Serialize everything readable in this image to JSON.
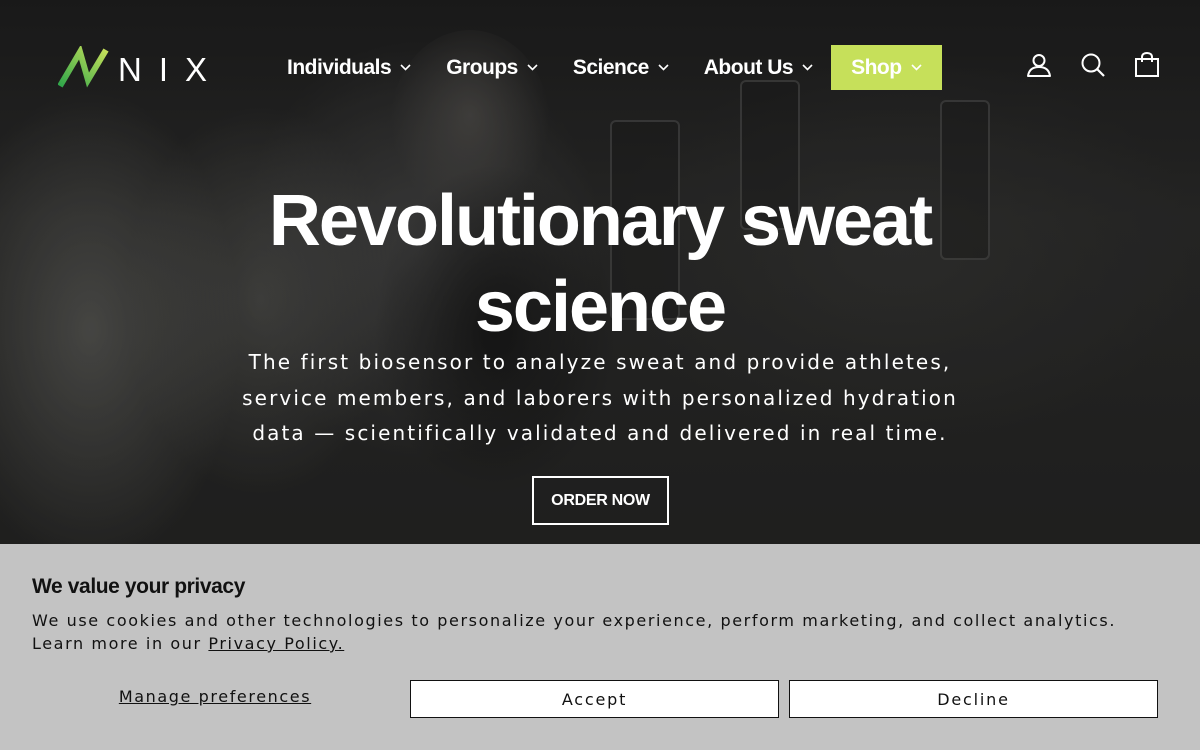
{
  "brand": {
    "name": "NIX",
    "accent_color": "#c6e05a"
  },
  "nav": {
    "items": [
      {
        "label": "Individuals",
        "icon": "chevron-down-icon"
      },
      {
        "label": "Groups",
        "icon": "chevron-down-icon"
      },
      {
        "label": "Science",
        "icon": "chevron-down-icon"
      },
      {
        "label": "About Us",
        "icon": "chevron-down-icon"
      },
      {
        "label": "Shop",
        "icon": "chevron-down-icon",
        "highlighted": true
      }
    ]
  },
  "header_icons": [
    "account-icon",
    "search-icon",
    "cart-icon"
  ],
  "hero": {
    "title_line1": "Revolutionary sweat",
    "title_line2": "science",
    "subtitle_line1": "The first biosensor to analyze sweat and provide athletes,",
    "subtitle_line2": "service members, and laborers with personalized hydration",
    "subtitle_line3": "data — scientifically validated and delivered in real time.",
    "cta_label": "ORDER NOW"
  },
  "cookie_banner": {
    "title": "We value your privacy",
    "text_line1": "We use cookies and other technologies to personalize your experience, perform marketing, and collect analytics.",
    "text_line2_prefix": "Learn more in our ",
    "privacy_link": "Privacy Policy.",
    "manage_label": "Manage preferences",
    "accept_label": "Accept",
    "decline_label": "Decline"
  }
}
